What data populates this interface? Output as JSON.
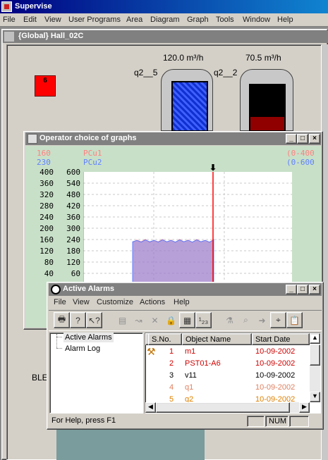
{
  "app": {
    "title": "Supervise",
    "menu": [
      "File",
      "Edit",
      "View",
      "User Programs",
      "Area",
      "Diagram",
      "Graph",
      "Tools",
      "Window",
      "Help"
    ]
  },
  "diagram": {
    "title": "{Global} Hall_02C",
    "alarm_box_label": "6",
    "flow_left_value": "120.0 m³/h",
    "flow_right_value": "70.5 m³/h",
    "tank_left_label": "q2__5",
    "tank_right_label": "q2__2",
    "side_label": "BLE"
  },
  "graph_window": {
    "title": "Operator choice of graphs",
    "legend": [
      {
        "value": "160",
        "name": "PCu1",
        "range": "(0-400",
        "color": "#ff8080"
      },
      {
        "value": "230",
        "name": "PCu2",
        "range": "(0-600",
        "color": "#6080ff"
      }
    ],
    "y_ticks_left": [
      "400",
      "360",
      "320",
      "280",
      "240",
      "200",
      "160",
      "120",
      "80",
      "40"
    ],
    "y_ticks_right": [
      "600",
      "540",
      "480",
      "420",
      "360",
      "300",
      "240",
      "180",
      "120",
      "60"
    ],
    "chart_data": {
      "type": "area",
      "ylim_left": [
        0,
        400
      ],
      "ylim_right": [
        0,
        600
      ],
      "series": [
        {
          "name": "PCu1",
          "color": "#ff8080",
          "values": [
            150,
            158,
            152,
            160,
            150,
            157,
            152,
            160,
            151,
            158,
            150,
            160,
            152,
            158,
            150,
            160,
            152,
            157,
            150,
            160
          ]
        },
        {
          "name": "PCu2",
          "color": "#6080ff",
          "values": [
            228,
            235,
            226,
            238,
            228,
            236,
            226,
            238,
            228,
            236,
            226,
            238,
            228,
            236,
            226,
            238,
            228,
            236,
            226,
            238
          ]
        }
      ],
      "cursor": "red vertical cursor line"
    }
  },
  "alarm_window": {
    "title": "Active Alarms",
    "menu": [
      "File",
      "View",
      "Customize",
      "Actions",
      "Help"
    ],
    "tree": [
      "Active Alarms",
      "Alarm Log"
    ],
    "columns": [
      "S.No.",
      "Object Name",
      "Start Date"
    ],
    "rows": [
      {
        "sno": "1",
        "name": "m1",
        "date": "10-09-2002",
        "color": "#d00000"
      },
      {
        "sno": "2",
        "name": "PST01-A6",
        "date": "10-09-2002",
        "color": "#d00000"
      },
      {
        "sno": "3",
        "name": "v11",
        "date": "10-09-2002",
        "color": "#000000"
      },
      {
        "sno": "4",
        "name": "q1",
        "date": "10-09-2002",
        "color": "#e08060"
      },
      {
        "sno": "5",
        "name": "q2",
        "date": "10-09-2002",
        "color": "#e08000"
      }
    ],
    "status_help": "For Help, press F1",
    "status_num": "NUM"
  }
}
